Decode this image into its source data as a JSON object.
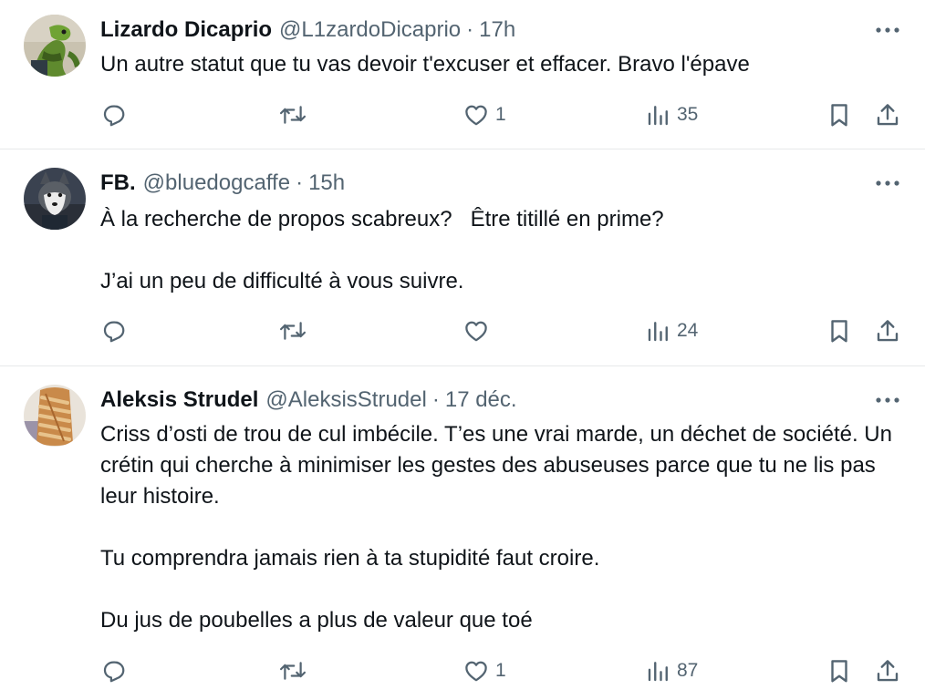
{
  "tweets": [
    {
      "name": "Lizardo Dicaprio",
      "handle": "@L1zardoDicaprio",
      "separator": "·",
      "time": "17h",
      "paragraphs": [
        "Un autre statut que tu vas devoir t'excuser et effacer. Bravo l'épave"
      ],
      "replies": "",
      "retweets": "",
      "likes": "1",
      "views": "35",
      "avatar_icon": "lizard-avatar"
    },
    {
      "name": "FB.",
      "handle": "@bluedogcaffe",
      "separator": "·",
      "time": "15h",
      "paragraphs": [
        "À la recherche de propos scabreux?   Être titillé en prime?",
        "J’ai un peu de difficulté à vous suivre."
      ],
      "replies": "",
      "retweets": "",
      "likes": "",
      "views": "24",
      "avatar_icon": "husky-avatar"
    },
    {
      "name": "Aleksis Strudel",
      "handle": "@AleksisStrudel",
      "separator": "·",
      "time": "17 déc.",
      "paragraphs": [
        "Criss d’osti de trou de cul imbécile. T’es une vrai marde, un déchet de société. Un crétin qui cherche à minimiser les gestes des abuseuses parce que tu ne lis pas leur histoire.",
        "Tu comprendra jamais rien à ta stupidité faut croire.",
        "Du jus de poubelles a plus de valeur que toé"
      ],
      "replies": "",
      "retweets": "",
      "likes": "1",
      "views": "87",
      "avatar_icon": "strudel-avatar"
    }
  ],
  "icons": {
    "more": "more-options-icon",
    "reply": "reply-icon",
    "retweet": "retweet-icon",
    "like": "like-icon",
    "views": "views-icon",
    "bookmark": "bookmark-icon",
    "share": "share-icon"
  },
  "colors": {
    "text": "#0f1419",
    "secondary": "#536471",
    "divider": "#e7e9ea"
  }
}
